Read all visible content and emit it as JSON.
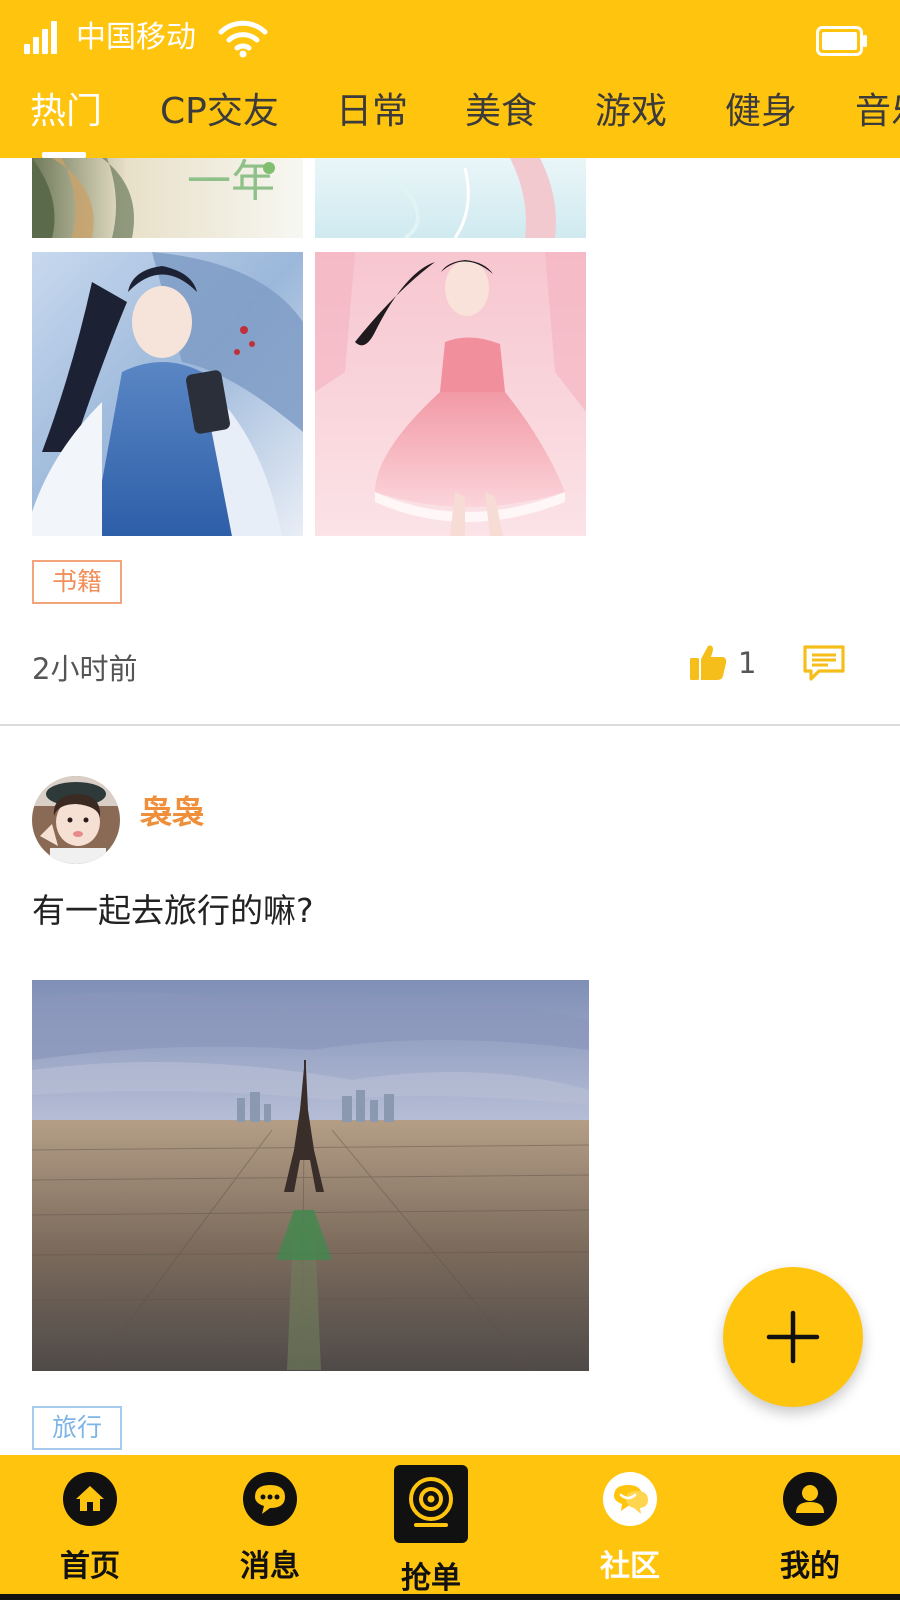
{
  "status_bar": {
    "carrier": "中国移动",
    "signal_icon": "signal-bars-icon",
    "wifi_icon": "wifi-icon",
    "battery_icon": "battery-icon"
  },
  "colors": {
    "brand": "#FFC40E",
    "username": "#F08F3A",
    "tag_book": "#F08F5A",
    "tag_travel": "#7FB5E6"
  },
  "tabs": {
    "items": [
      {
        "label": "热门"
      },
      {
        "label": "CP交友"
      },
      {
        "label": "日常"
      },
      {
        "label": "美食"
      },
      {
        "label": "游戏"
      },
      {
        "label": "健身"
      },
      {
        "label": "音乐"
      }
    ]
  },
  "feed": {
    "post1": {
      "tag": "书籍",
      "time": "2小时前",
      "like_count": "1",
      "like_icon": "thumbs-up-icon",
      "comment_icon": "comment-icon"
    },
    "post2": {
      "username": "袅袅",
      "text": "有一起去旅行的嘛?",
      "tag": "旅行"
    }
  },
  "fab": {
    "icon": "plus-icon"
  },
  "bottom_nav": {
    "items": [
      {
        "label": "首页",
        "icon": "home-icon"
      },
      {
        "label": "消息",
        "icon": "chat-icon"
      },
      {
        "label": "抢单",
        "icon": "camera-icon"
      },
      {
        "label": "社区",
        "icon": "community-icon"
      },
      {
        "label": "我的",
        "icon": "profile-icon"
      }
    ]
  }
}
